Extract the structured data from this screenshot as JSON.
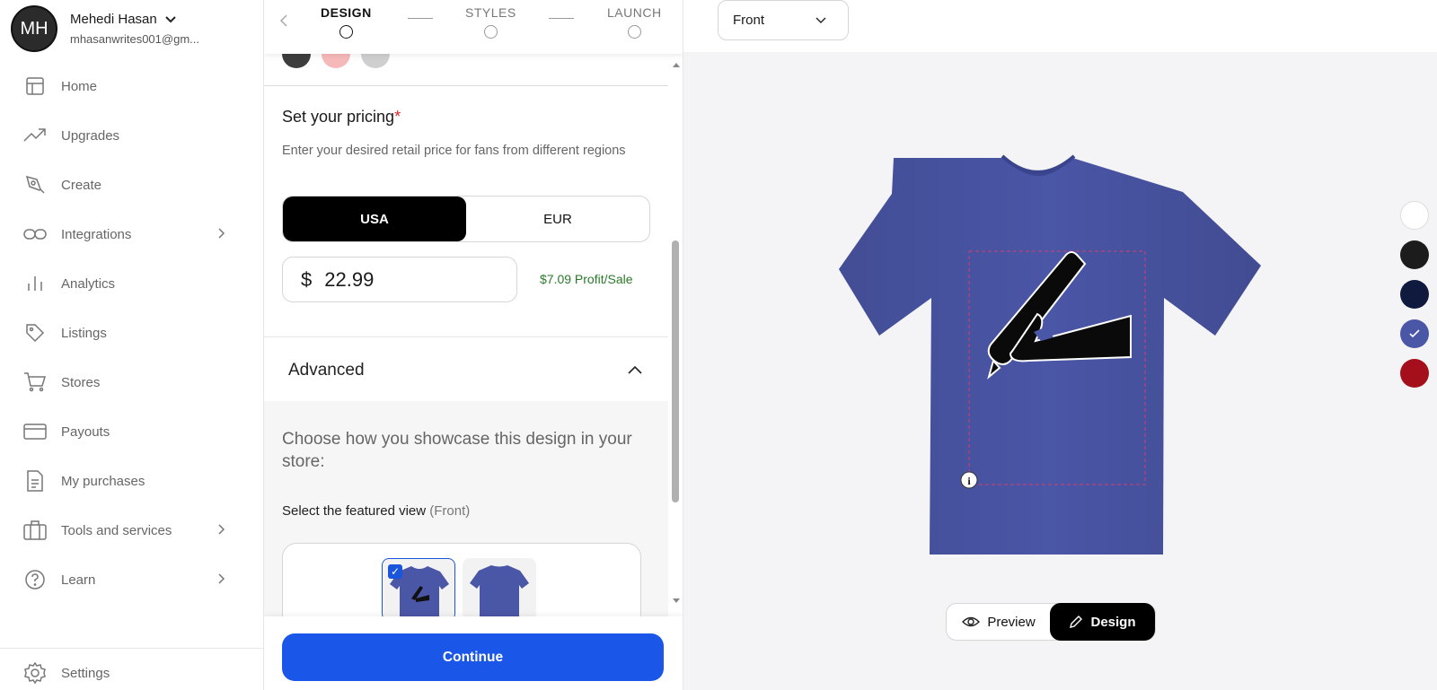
{
  "profile": {
    "initials": "MH",
    "name": "Mehedi Hasan",
    "email": "mhasanwrites001@gm..."
  },
  "sidebar": {
    "items": [
      {
        "label": "Home",
        "icon": "layout-icon"
      },
      {
        "label": "Upgrades",
        "icon": "trend-icon"
      },
      {
        "label": "Create",
        "icon": "pen-tool-icon"
      },
      {
        "label": "Integrations",
        "icon": "link-icon"
      },
      {
        "label": "Analytics",
        "icon": "bar-chart-icon"
      },
      {
        "label": "Listings",
        "icon": "tag-icon"
      },
      {
        "label": "Stores",
        "icon": "cart-icon"
      },
      {
        "label": "Payouts",
        "icon": "card-icon"
      },
      {
        "label": "My purchases",
        "icon": "document-icon"
      },
      {
        "label": "Tools and services",
        "icon": "briefcase-icon"
      },
      {
        "label": "Learn",
        "icon": "help-icon"
      }
    ],
    "settings_label": "Settings"
  },
  "stepper": {
    "steps": [
      "DESIGN",
      "STYLES",
      "LAUNCH"
    ],
    "active": "DESIGN"
  },
  "pricing": {
    "title": "Set your pricing",
    "required_mark": "*",
    "description": "Enter your desired retail price for fans from different regions",
    "regions": [
      "USA",
      "EUR"
    ],
    "selected_region": "USA",
    "currency_symbol": "$",
    "price": "22.99",
    "profit": "$7.09 Profit/Sale"
  },
  "advanced": {
    "label": "Advanced",
    "showcase_text": "Choose how you showcase this design in your store:",
    "featured_label": "Select the featured view",
    "featured_value": "(Front)"
  },
  "footer": {
    "continue_label": "Continue"
  },
  "canvas": {
    "view_select": "Front",
    "shirt_color": "#4a56a6",
    "colors": [
      "#ffffff",
      "#1c1c1c",
      "#101a3f",
      "#4a56a6",
      "#a50e1b"
    ],
    "selected_color": "#4a56a6",
    "preview_label": "Preview",
    "design_label": "Design"
  }
}
